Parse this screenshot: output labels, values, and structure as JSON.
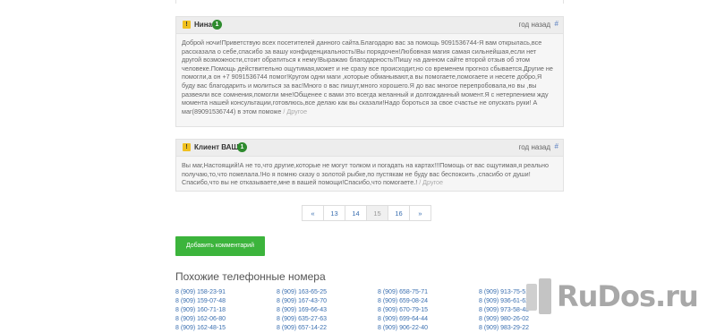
{
  "comments": [
    {
      "author": "Нина",
      "badge": "1",
      "time": "год назад",
      "hash": "#",
      "text": "Доброй ночи!Приветствую всех посетителей данного сайта.Благодарю вас за помощь 9091536744-Я вам открылась,все рассказала о себе,спасибо за вашу конфиденциальность!Вы порядочен!Любовная магия самая сильнейшая,если нет другой возможности,стоит обратиться к нему!Выражаю благодарность!Пишу на данном сайте второй отзыв об этом человеке.Помощь действительно ощутимая,может и не сразу все происходит,но со временем прогноз сбывается.Другие не помогли,а он +7 9091536744 помог!Кругом одни маги ,которые обманывают,а вы помогаете,помогаете и несете добро,Я буду вас благодарить и молиться за вас!Много о вас пишут,много хорошего.Я до вас многое перепробовала,но вы ,вы развеяли все сомнения,помогли мне!Общенее с вами это всегда желанный и долгожданный момент.Я с нетерпением жду момента нашей консультации,готовлюсь,все делаю как вы сказали!Надо бороться за свое счастье не опускать руки! А маг(89091536744) в этом поможе",
      "reply": "/ Другое"
    },
    {
      "author": "Клиент ВАШ!",
      "badge": "1",
      "time": "год назад",
      "hash": "#",
      "text": "Вы маг,Настоящий!А не то,что другие,которые не могут толком и погадать на картах!!!Помощь от вас ощутимая,я реально получаю,то,что пожелала.!Но я помню сказу о золотой рыбке,по пустякам не буду вас беспокоить ,спасибо от души! Спасибо,что вы не отказываете,мне в вашей помощи!Спасибо,что помогаете.!",
      "reply": "/ Другое"
    }
  ],
  "pagination": [
    "«",
    "13",
    "14",
    "15",
    "16",
    "»"
  ],
  "pagination_active": "15",
  "add_comment_button": "Добавить комментарий",
  "similar_title": "Похожие телефонные номера",
  "phone_columns": [
    [
      "8 (909) 158-23-91",
      "8 (909) 159-07-48",
      "8 (909) 160-71-18",
      "8 (909) 162-06-80",
      "8 (909) 162-48-15"
    ],
    [
      "8 (909) 163-65-25",
      "8 (909) 167-43-70",
      "8 (909) 169-66-43",
      "8 (909) 635-27-63",
      "8 (909) 657-14-22"
    ],
    [
      "8 (909) 658-75-71",
      "8 (909) 659-08-24",
      "8 (909) 670-79-15",
      "8 (909) 699-64-44",
      "8 (909) 906-22-40"
    ],
    [
      "8 (909) 913-75-51",
      "8 (909) 936-61-62",
      "8 (909) 973-58-48",
      "8 (909) 980-26-02",
      "8 (909) 983-29-22"
    ]
  ],
  "watermark": "RuDos.ru"
}
